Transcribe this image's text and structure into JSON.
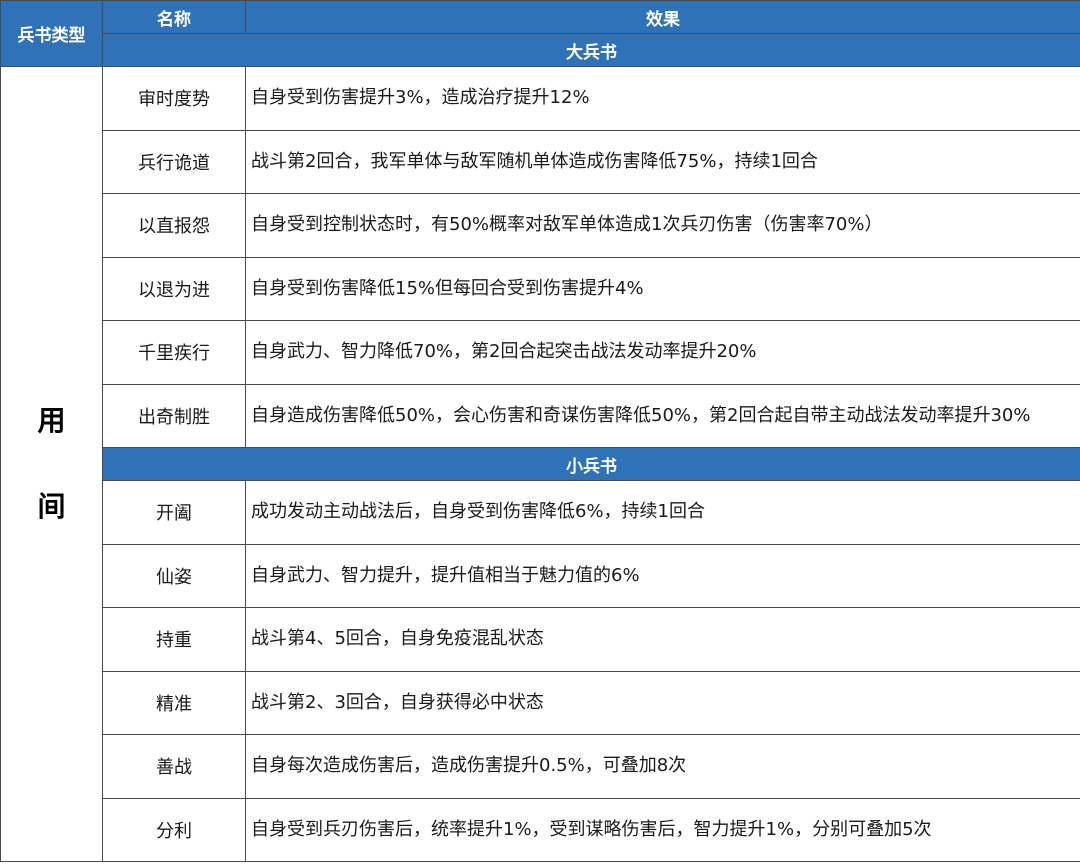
{
  "header": {
    "type_label": "兵书类型",
    "name_label": "名称",
    "effect_label": "效果"
  },
  "type_value": [
    "用",
    "间"
  ],
  "big_section": {
    "title": "大兵书",
    "rows": [
      {
        "name": "审时度势",
        "effect": "自身受到伤害提升3%，造成治疗提升12%"
      },
      {
        "name": "兵行诡道",
        "effect": "战斗第2回合，我军单体与敌军随机单体造成伤害降低75%，持续1回合"
      },
      {
        "name": "以直报怨",
        "effect": "自身受到控制状态时，有50%概率对敌军单体造成1次兵刃伤害（伤害率70%）"
      },
      {
        "name": "以退为进",
        "effect": "自身受到伤害降低15%但每回合受到伤害提升4%"
      },
      {
        "name": "千里疾行",
        "effect": "自身武力、智力降低70%，第2回合起突击战法发动率提升20%"
      },
      {
        "name": "出奇制胜",
        "effect": "自身造成伤害降低50%，会心伤害和奇谋伤害降低50%，第2回合起自带主动战法发动率提升30%"
      }
    ]
  },
  "small_section": {
    "title": "小兵书",
    "rows": [
      {
        "name": "开阖",
        "effect": "成功发动主动战法后，自身受到伤害降低6%，持续1回合"
      },
      {
        "name": "仙姿",
        "effect": "自身武力、智力提升，提升值相当于魅力值的6%"
      },
      {
        "name": "持重",
        "effect": "战斗第4、5回合，自身免疫混乱状态"
      },
      {
        "name": "精准",
        "effect": "战斗第2、3回合，自身获得必中状态"
      },
      {
        "name": "善战",
        "effect": "自身每次造成伤害后，造成伤害提升0.5%，可叠加8次"
      },
      {
        "name": "分利",
        "effect": "自身受到兵刃伤害后，统率提升1%，受到谋略伤害后，智力提升1%，分别可叠加5次"
      }
    ]
  }
}
